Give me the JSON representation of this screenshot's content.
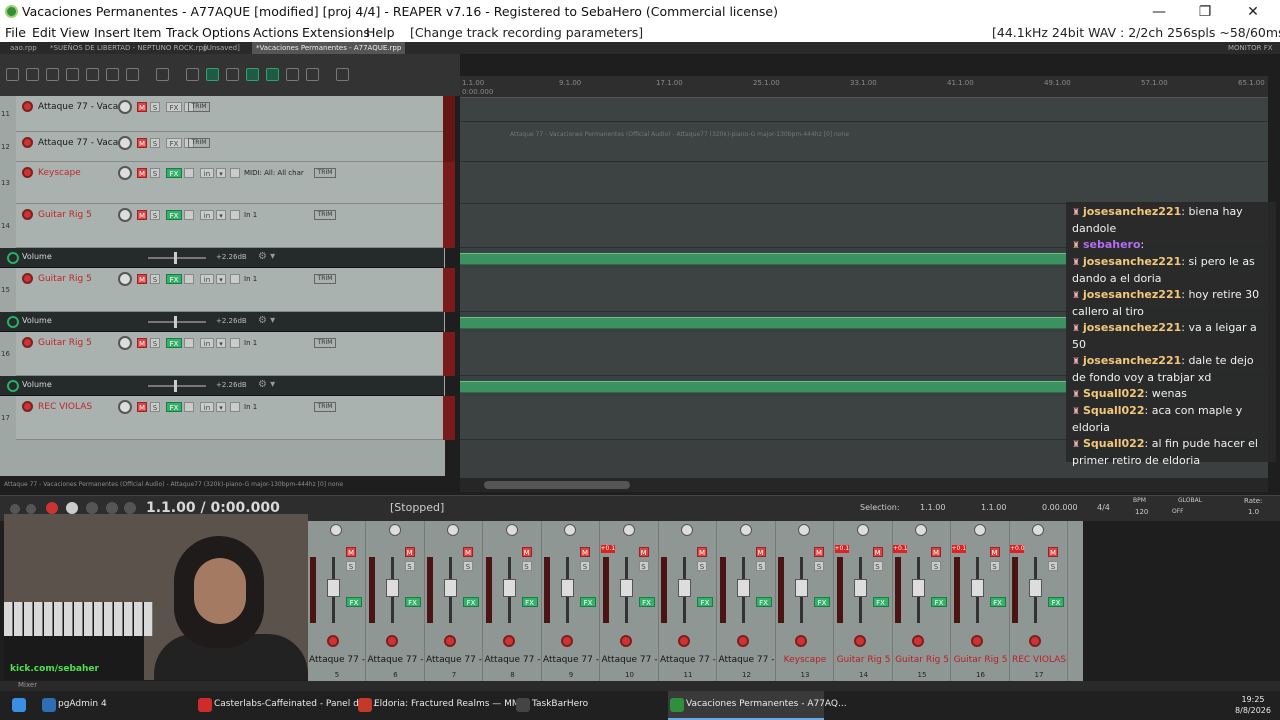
{
  "window": {
    "title": "Vacaciones Permanentes - A77AQUE [modified] [proj 4/4] - REAPER v7.16 - Registered to SebaHero (Commercial license)",
    "minimize": "—",
    "maximize": "❐",
    "close": "✕"
  },
  "menu": {
    "items": [
      "File",
      "Edit",
      "View",
      "Insert",
      "Item",
      "Track",
      "Options",
      "Actions",
      "Extensions",
      "Help"
    ],
    "action_hint": "[Change track recording parameters]",
    "audio_status": "[44.1kHz 24bit WAV : 2/2ch 256spls ~58/60ms ASIO]"
  },
  "tabs": [
    {
      "label": "aao.rpp"
    },
    {
      "label": "*SUEÑOS DE LIBERTAD - NEPTUNO ROCK.rpp"
    },
    {
      "label": "[Unsaved]"
    },
    {
      "label": "*Vacaciones Permanentes - A77AQUE.rpp"
    },
    {
      "label": "MONITOR FX"
    }
  ],
  "tracks": [
    {
      "num": "11",
      "name": "Attaque 77 - Vaca",
      "color": "dark",
      "input": ""
    },
    {
      "num": "12",
      "name": "Attaque 77 - Vaca",
      "color": "dark",
      "input": ""
    },
    {
      "num": "13",
      "name": "Keyscape",
      "color": "red",
      "input": "MIDI: All: All char"
    },
    {
      "num": "14",
      "name": "Guitar Rig 5",
      "color": "red",
      "input": "In 1"
    },
    {
      "num": "15",
      "name": "Guitar Rig 5",
      "color": "red",
      "input": "In 1"
    },
    {
      "num": "16",
      "name": "Guitar Rig 5",
      "color": "red",
      "input": "In 1"
    },
    {
      "num": "17",
      "name": "REC VIOLAS",
      "color": "red",
      "input": "In 1"
    }
  ],
  "envelopes": [
    {
      "label": "Volume",
      "db": "+2.26dB"
    },
    {
      "label": "Volume",
      "db": "+2.26dB"
    },
    {
      "label": "Volume",
      "db": "+2.26dB"
    }
  ],
  "track_buttons": {
    "mute": "M",
    "solo": "S",
    "fx": "FX",
    "in": "in",
    "trim": "TRIM"
  },
  "ruler": [
    "1.1.00",
    "9.1.00",
    "17.1.00",
    "25.1.00",
    "33.1.00",
    "41.1.00",
    "49.1.00",
    "57.1.00",
    "65.1.00"
  ],
  "ruler_sub": "0:00.000",
  "clip_name": "Attaque 77 - Vacaciones Permanentes (Official Audio) - Attaque77 (320k)-piano-G major-130bpm-444hz [0] none",
  "status_line": "Attaque 77 - Vacaciones Permanentes (Official Audio) - Attaque77 (320k)-piano-G major-130bpm-444hz [0] none",
  "chat": [
    {
      "user": "josesanchez221",
      "text": ": biena hay dandole",
      "color": "#f3c87a"
    },
    {
      "user": "sebahero",
      "text": ":",
      "color": "#b46cf2"
    },
    {
      "user": "josesanchez221",
      "text": ": si pero le as dando a el doria",
      "color": "#f3c87a"
    },
    {
      "user": "josesanchez221",
      "text": ": hoy retire 30 callero al tiro",
      "color": "#f3c87a"
    },
    {
      "user": "josesanchez221",
      "text": ": va a leigar a 50",
      "color": "#f3c87a"
    },
    {
      "user": "josesanchez221",
      "text": ": dale te dejo de fondo voy a trabjar xd",
      "color": "#f3c87a"
    },
    {
      "user": "Squall022",
      "text": ": wenas",
      "color": "#f3c87a"
    },
    {
      "user": "Squall022",
      "text": ": aca con maple y eldoria",
      "color": "#f3c87a"
    },
    {
      "user": "Squall022",
      "text": ": al fin pude hacer el primer retiro de eldoria",
      "color": "#f3c87a"
    }
  ],
  "transport": {
    "time": "1.1.00 / 0:00.000",
    "state": "[Stopped]",
    "selection_label": "Selection:",
    "sel_start": "1.1.00",
    "sel_end": "1.1.00",
    "sel_len": "0.00.000",
    "timesig": "4/4",
    "bpm_label": "BPM",
    "bpm": "120",
    "global_label": "GLOBAL",
    "global_state": "OFF",
    "rate_label": "Rate:",
    "rate": "1.0"
  },
  "mixer": {
    "strips": [
      {
        "name": "Attaque 77 -",
        "num": "5",
        "color": "dark",
        "clip": ""
      },
      {
        "name": "Attaque 77 -",
        "num": "6",
        "color": "dark",
        "clip": ""
      },
      {
        "name": "Attaque 77 -",
        "num": "7",
        "color": "dark",
        "clip": ""
      },
      {
        "name": "Attaque 77 -",
        "num": "8",
        "color": "dark",
        "clip": ""
      },
      {
        "name": "Attaque 77 -",
        "num": "9",
        "color": "dark",
        "clip": ""
      },
      {
        "name": "Attaque 77 -",
        "num": "10",
        "color": "dark",
        "clip": "+0.1"
      },
      {
        "name": "Attaque 77 -",
        "num": "11",
        "color": "dark",
        "clip": ""
      },
      {
        "name": "Attaque 77 -",
        "num": "12",
        "color": "dark",
        "clip": ""
      },
      {
        "name": "Keyscape",
        "num": "13",
        "color": "red",
        "clip": ""
      },
      {
        "name": "Guitar Rig 5",
        "num": "14",
        "color": "red",
        "clip": "+0.1"
      },
      {
        "name": "Guitar Rig 5",
        "num": "15",
        "color": "red",
        "clip": "+0.1"
      },
      {
        "name": "Guitar Rig 5",
        "num": "16",
        "color": "red",
        "clip": "+0.1"
      },
      {
        "name": "REC VIOLAS",
        "num": "17",
        "color": "red",
        "clip": "+0.0"
      }
    ],
    "label": "Mixer"
  },
  "webcam": {
    "watermark": "kick.com/sebaher"
  },
  "taskbar": {
    "items": [
      {
        "label": "pgAdmin 4",
        "color": "#2f6db5"
      },
      {
        "label": "Casterlabs-Caffeinated - Panel de ...",
        "color": "#d02b2b"
      },
      {
        "label": "Eldoria: Fractured Realms — MM...",
        "color": "#c23a2a"
      },
      {
        "label": "TaskBarHero",
        "color": "#444444"
      },
      {
        "label": "Vacaciones Permanentes - A77AQ...",
        "color": "#2f8f3b"
      }
    ],
    "time": "19:25",
    "date": "8/8/2026"
  },
  "colors": {
    "accent_green": "#3b9160",
    "track_red": "#c0262c",
    "record": "#cc3333"
  }
}
